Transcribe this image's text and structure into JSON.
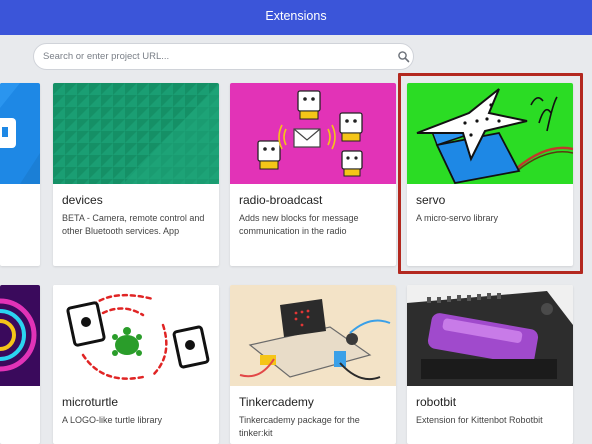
{
  "header": {
    "title": "Extensions"
  },
  "search": {
    "placeholder": "Search or enter project URL..."
  },
  "cards": [
    {
      "title": "devices",
      "description": "BETA - Camera, remote control and other Bluetooth services. App"
    },
    {
      "title": "radio-broadcast",
      "description": "Adds new blocks for message communication in the radio"
    },
    {
      "title": "servo",
      "description": "A micro-servo library"
    },
    {
      "title": "microturtle",
      "description": "A LOGO-like turtle library"
    },
    {
      "title": "Tinkercademy",
      "description": "Tinkercademy package for the tinker:kit"
    },
    {
      "title": "robotbit",
      "description": "Extension for Kittenbot Robotbit"
    }
  ],
  "colors": {
    "header": "#3b55d9",
    "selection_border": "#b3281f",
    "devices_tile": "#1a9e73",
    "radio_tile": "#e233b7",
    "servo_tile": "#2bdc24"
  }
}
